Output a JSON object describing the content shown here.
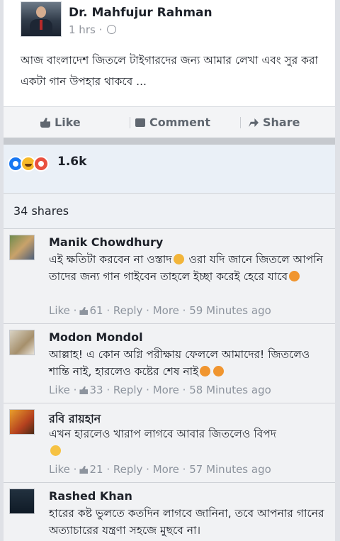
{
  "post": {
    "author": "Dr. Mahfujur Rahman",
    "time": "1 hrs ·",
    "text": "আজ বাংলাদেশ জিতলে টাইগারদের জন্য আমার লেখা এবং সুর করা একটা গান উপহার থাকবে ..."
  },
  "actions": {
    "like": "Like",
    "comment": "Comment",
    "share": "Share"
  },
  "reactions": {
    "count": "1.6k",
    "icons": [
      "like-icon",
      "haha-icon",
      "angry-icon"
    ]
  },
  "shares": "34 shares",
  "comments": [
    {
      "name": "Manik Chowdhury",
      "text": "এই ক্ষতিটা করবেন না ওস্তাদ",
      "text_b": " ওরা যদি জানে জিতলে আপনি তাদের জন্য গান গাইবেন তাহলে ইচ্ছা করেই হেরে যাবে",
      "like": "Like",
      "likes": "61",
      "reply": "Reply",
      "more": "More",
      "time": "59 Minutes ago"
    },
    {
      "name": "Modon Mondol",
      "text": "আল্লাহ! এ কোন অগ্নি পরীক্ষায় ফেললে আমাদের! জিতলেও শান্তি নাই, হারলেও কষ্টের শেষ নাই",
      "like": "Like",
      "likes": "33",
      "reply": "Reply",
      "more": "More",
      "time": "58 Minutes ago"
    },
    {
      "name": "রবি রায়হান",
      "text": "এখন হারলেও খারাপ লাগবে আবার জিতলেও বিপদ",
      "like": "Like",
      "likes": "21",
      "reply": "Reply",
      "more": "More",
      "time": "57 Minutes ago"
    },
    {
      "name": "Rashed Khan",
      "text": "হারের কষ্ট ভুলতে কতদিন লাগবে জানিনা, তবে আপনার গানের অত্যাচারের যন্ত্রণা সহজে মুছবে না।"
    }
  ],
  "colors": {
    "link": "#1877f2",
    "meta": "#90949c",
    "bg": "#e4e6eb"
  }
}
